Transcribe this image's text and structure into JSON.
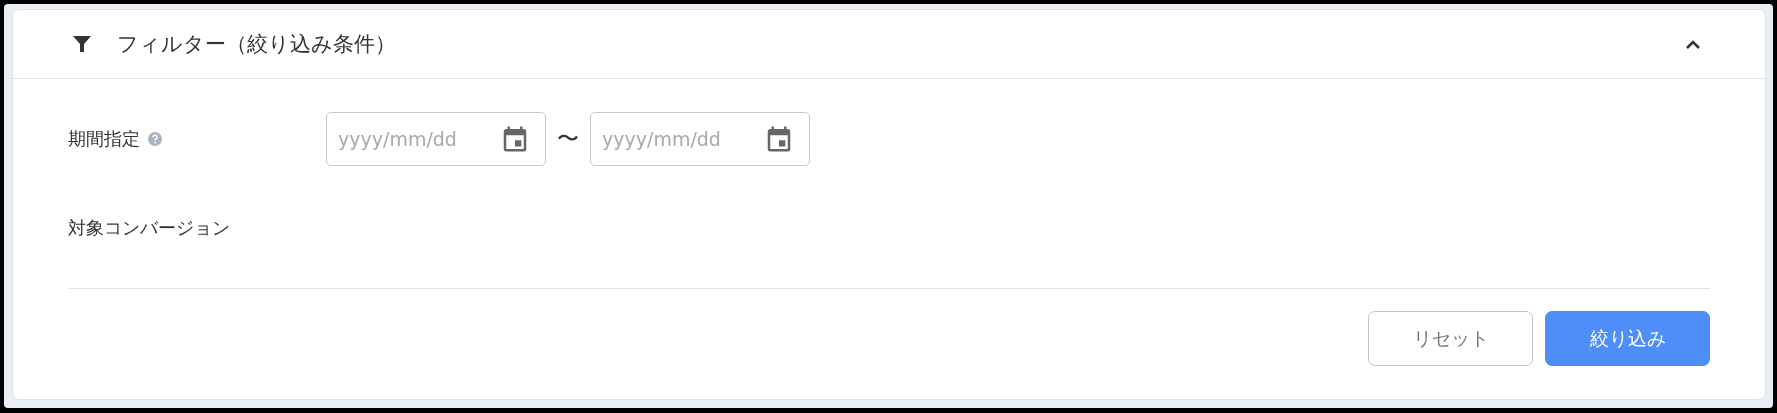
{
  "filter": {
    "title": "フィルター（絞り込み条件）",
    "expanded": true,
    "period": {
      "label": "期間指定",
      "fields": [
        {
          "placeholder": "yyyy/mm/dd"
        },
        {
          "placeholder": "yyyy/mm/dd"
        }
      ],
      "separator": "〜"
    },
    "conversion": {
      "label": "対象コンバージョン"
    },
    "buttons": [
      {
        "kind": "secondary",
        "label": "リセット"
      },
      {
        "kind": "primary",
        "label": "絞り込み"
      }
    ]
  }
}
